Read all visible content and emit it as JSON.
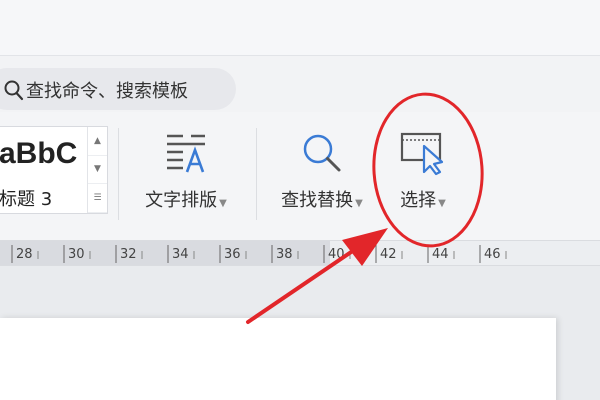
{
  "search": {
    "text": "查找命令、搜索模板"
  },
  "style_gallery": {
    "preview": "aBbC",
    "style_name": "标题 3"
  },
  "tools": [
    {
      "label": "文字排版",
      "icon": "text-layout-icon"
    },
    {
      "label": "查找替换",
      "icon": "magnifier-icon"
    },
    {
      "label": "选择",
      "icon": "select-cursor-icon"
    }
  ],
  "ruler": {
    "ticks": [
      "28",
      "30",
      "32",
      "34",
      "36",
      "38",
      "40",
      "42",
      "44",
      "46"
    ]
  },
  "colors": {
    "annotation": "#e2262a",
    "ruler_shade": "#d9dbe0"
  }
}
